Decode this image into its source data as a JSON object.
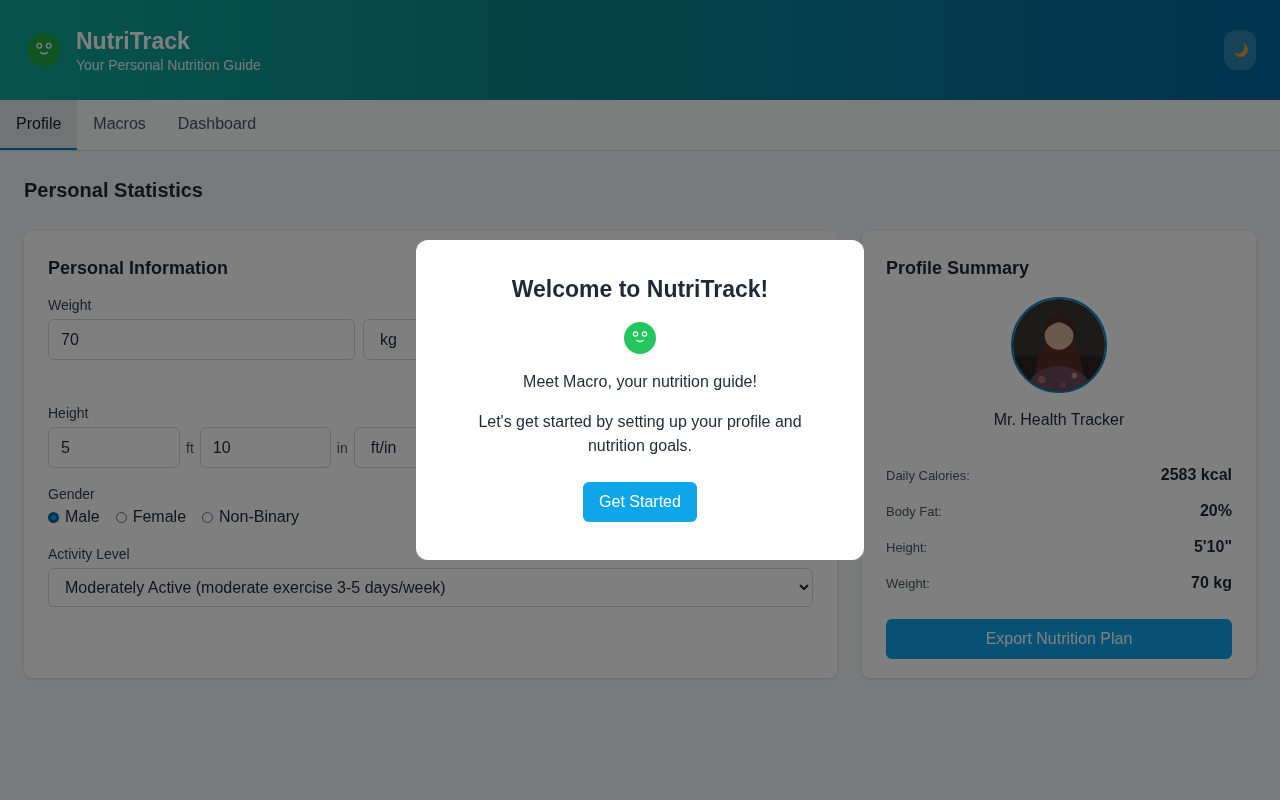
{
  "header": {
    "title": "NutriTrack",
    "subtitle": "Your Personal Nutrition Guide"
  },
  "tabs": [
    {
      "label": "Profile",
      "selected": true
    },
    {
      "label": "Macros",
      "selected": false
    },
    {
      "label": "Dashboard",
      "selected": false
    }
  ],
  "page_title": "Personal Statistics",
  "personal_info": {
    "title": "Personal Information",
    "weight": {
      "label": "Weight",
      "value": "70",
      "unit": "kg"
    },
    "height": {
      "label": "Height",
      "feet": "5",
      "feet_unit": "ft",
      "inches": "10",
      "inches_unit": "in",
      "unit": "ft/in"
    },
    "gender": {
      "label": "Gender",
      "options": [
        {
          "label": "Male",
          "selected": true
        },
        {
          "label": "Female",
          "selected": false
        },
        {
          "label": "Non-Binary",
          "selected": false
        }
      ]
    },
    "activity": {
      "label": "Activity Level",
      "value": "Moderately Active (moderate exercise 3-5 days/week)"
    }
  },
  "summary": {
    "title": "Profile Summary",
    "name": "Mr. Health Tracker",
    "stats": [
      {
        "label": "Daily Calories:",
        "value": "2583 kcal"
      },
      {
        "label": "Body Fat:",
        "value": "20%"
      },
      {
        "label": "Height:",
        "value": "5'10\""
      },
      {
        "label": "Weight:",
        "value": "70 kg"
      }
    ],
    "button": "Export Nutrition Plan"
  },
  "modal": {
    "title": "Welcome to NutriTrack!",
    "lines": [
      "Meet Macro, your nutrition guide!",
      "Let's get started by setting up your profile and nutrition goals."
    ],
    "button": "Get Started"
  }
}
